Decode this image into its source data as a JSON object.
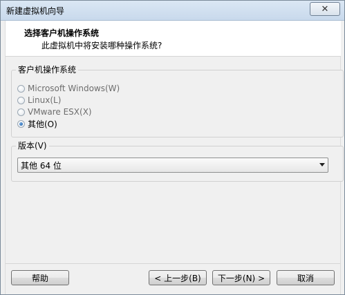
{
  "window": {
    "title": "新建虚拟机向导",
    "close_symbol": "✕"
  },
  "header": {
    "title": "选择客户机操作系统",
    "subtitle": "此虚拟机中将安装哪种操作系统?"
  },
  "os_group": {
    "legend": "客户机操作系统",
    "options": [
      {
        "label": "Microsoft Windows(W)",
        "checked": false
      },
      {
        "label": "Linux(L)",
        "checked": false
      },
      {
        "label": "VMware ESX(X)",
        "checked": false
      },
      {
        "label": "其他(O)",
        "checked": true
      }
    ]
  },
  "version_group": {
    "legend": "版本(V)",
    "selected": "其他 64 位"
  },
  "buttons": {
    "help": "帮助",
    "back": "< 上一步(B)",
    "next": "下一步(N) >",
    "cancel": "取消"
  },
  "icons": {
    "close": "close-icon",
    "dropdown": "chevron-down-icon"
  }
}
